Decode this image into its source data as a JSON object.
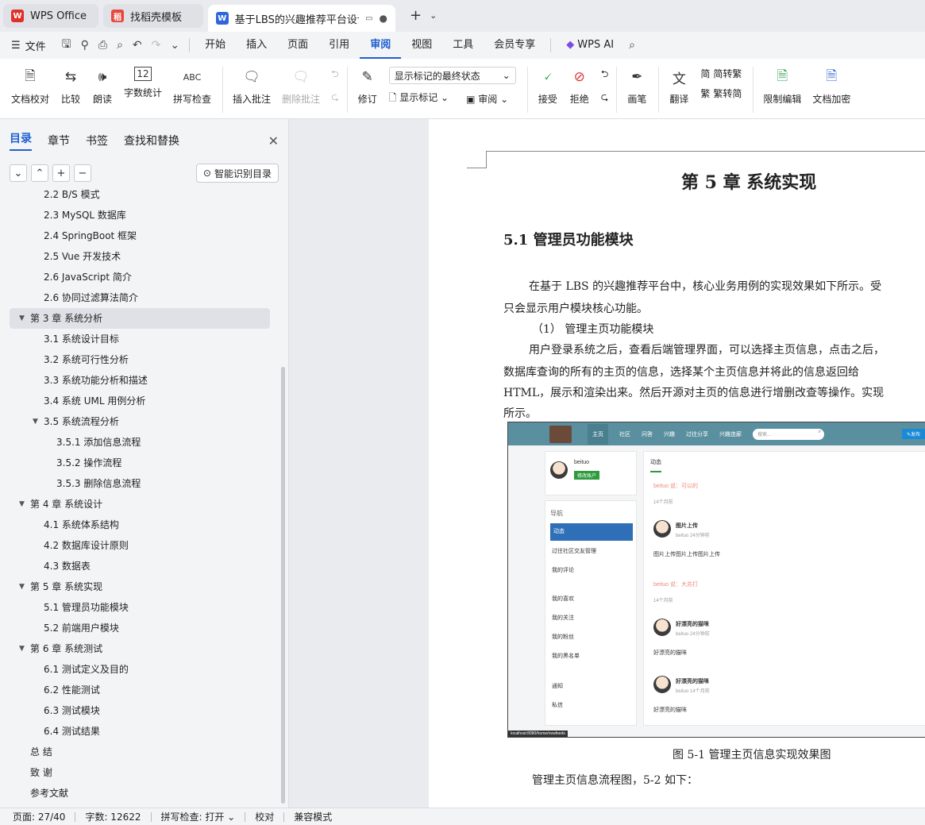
{
  "tabs": [
    {
      "label": "WPS Office",
      "icon": "wps-logo-icon"
    },
    {
      "label": "找稻壳模板",
      "icon": "docer-icon"
    },
    {
      "label": "基于LBS的兴趣推荐平台设计与",
      "icon": "word-doc-icon",
      "active": true
    }
  ],
  "menu": {
    "file": "文件",
    "items": [
      "开始",
      "插入",
      "页面",
      "引用",
      "审阅",
      "视图",
      "工具",
      "会员专享"
    ],
    "active": "审阅",
    "ai": "WPS AI"
  },
  "ribbon": {
    "proof": "文档校对",
    "compare": "比较",
    "read": "朗读",
    "wordcount": "字数统计",
    "spell": "拼写检查",
    "insert_comment": "插入批注",
    "delete_comment": "删除批注",
    "track": "修订",
    "markup_select": "显示标记的最终状态",
    "show_markup": "显示标记",
    "review": "审阅",
    "accept": "接受",
    "reject": "拒绝",
    "pen": "画笔",
    "translate": "翻译",
    "to_trad": "简转繁",
    "to_simp": "繁转简",
    "restrict": "限制编辑",
    "encrypt": "文档加密"
  },
  "sidebar": {
    "tabs": [
      "目录",
      "章节",
      "书签",
      "查找和替换"
    ],
    "smart_toc": "智能识别目录",
    "toc": [
      {
        "t": "2.2 B/S 模式",
        "lv": 2
      },
      {
        "t": "2.3 MySQL 数据库",
        "lv": 2
      },
      {
        "t": "2.4 SpringBoot 框架",
        "lv": 2
      },
      {
        "t": "2.5 Vue 开发技术",
        "lv": 2
      },
      {
        "t": "2.6 JavaScript 简介",
        "lv": 2
      },
      {
        "t": "2.6  协同过滤算法简介",
        "lv": 2
      },
      {
        "t": "第 3 章  系统分析",
        "lv": 1,
        "exp": true,
        "sel": true
      },
      {
        "t": "3.1  系统设计目标",
        "lv": 2
      },
      {
        "t": "3.2  系统可行性分析",
        "lv": 2
      },
      {
        "t": "3.3  系统功能分析和描述",
        "lv": 2
      },
      {
        "t": "3.4  系统 UML 用例分析",
        "lv": 2
      },
      {
        "t": "3.5 系统流程分析",
        "lv": 2,
        "exp": true
      },
      {
        "t": "3.5.1 添加信息流程",
        "lv": 3
      },
      {
        "t": "3.5.2 操作流程",
        "lv": 3
      },
      {
        "t": "3.5.3 删除信息流程",
        "lv": 3
      },
      {
        "t": "第 4 章  系统设计",
        "lv": 1,
        "exp": true
      },
      {
        "t": "4.1  系统体系结构",
        "lv": 2
      },
      {
        "t": "4.2  数据库设计原则",
        "lv": 2
      },
      {
        "t": "4.3  数据表",
        "lv": 2
      },
      {
        "t": "第 5 章  系统实现",
        "lv": 1,
        "exp": true
      },
      {
        "t": "5.1  管理员功能模块",
        "lv": 2
      },
      {
        "t": "5.2  前端用户模块",
        "lv": 2
      },
      {
        "t": "第 6 章  系统测试",
        "lv": 1,
        "exp": true
      },
      {
        "t": "6.1 测试定义及目的",
        "lv": 2
      },
      {
        "t": "6.2 性能测试",
        "lv": 2
      },
      {
        "t": "6.3 测试模块",
        "lv": 2
      },
      {
        "t": "6.4 测试结果",
        "lv": 2
      },
      {
        "t": "总    结",
        "lv": 1
      },
      {
        "t": "致    谢",
        "lv": 1
      },
      {
        "t": "参考文献",
        "lv": 1
      }
    ]
  },
  "doc": {
    "chapter": "第 5 章  系统实现",
    "section": "5.1  管理员功能模块",
    "p1a": "在基于 LBS 的兴趣推荐平台中，核心业务用例的实现效果如下所示。受",
    "p1b": "只会显示用户模块核心功能。",
    "sub": "（1）  管理主页功能模块",
    "p2a": "用户登录系统之后，查看后端管理界面，可以选择主页信息，点击之后，",
    "p2b": "数据库查询的所有的主页的信息，选择某个主页信息并将此的信息返回给",
    "p2c": "HTML，展示和渲染出来。然后开源对主页的信息进行增删改查等操作。实现",
    "p2d": "所示。",
    "caption": "图 5-1  管理主页信息实现效果图",
    "p3": "管理主页信息流程图，5-2 如下："
  },
  "shot": {
    "nav": [
      "主页",
      "社区",
      "问答",
      "兴趣",
      "过往分享",
      "兴趣连廊"
    ],
    "search": "搜索...",
    "publish": "发布",
    "user": "beituo",
    "edit": "修改账户",
    "tab": "动态",
    "nav_title": "导航",
    "menu": [
      "动态",
      "过往社区交友管理",
      "我的评论",
      "我的喜欢",
      "我的关注",
      "我的粉丝",
      "我的黑名单",
      "通知",
      "私信"
    ],
    "f1": "beituo 说：可以的",
    "t1": "14个月前",
    "s1": "图片上传",
    "m1": "beituo 24分钟前",
    "b1": "图片上传图片上传图片上传",
    "f2": "beituo 说：大苏打",
    "t2": "14个月前",
    "s2": "好漂亮的猫咪",
    "m2": "beituo 24分钟前",
    "b2": "好漂亮的猫咪",
    "s3": "好漂亮的猫咪",
    "m3": "beituo 14个月前",
    "b3": "好漂亮的猫咪",
    "url": "localhost:8080/home/newfeeds"
  },
  "status": {
    "page": "页面: 27/40",
    "words": "字数: 12622",
    "spell": "拼写检查: 打开",
    "proof": "校对",
    "mode": "兼容模式"
  }
}
